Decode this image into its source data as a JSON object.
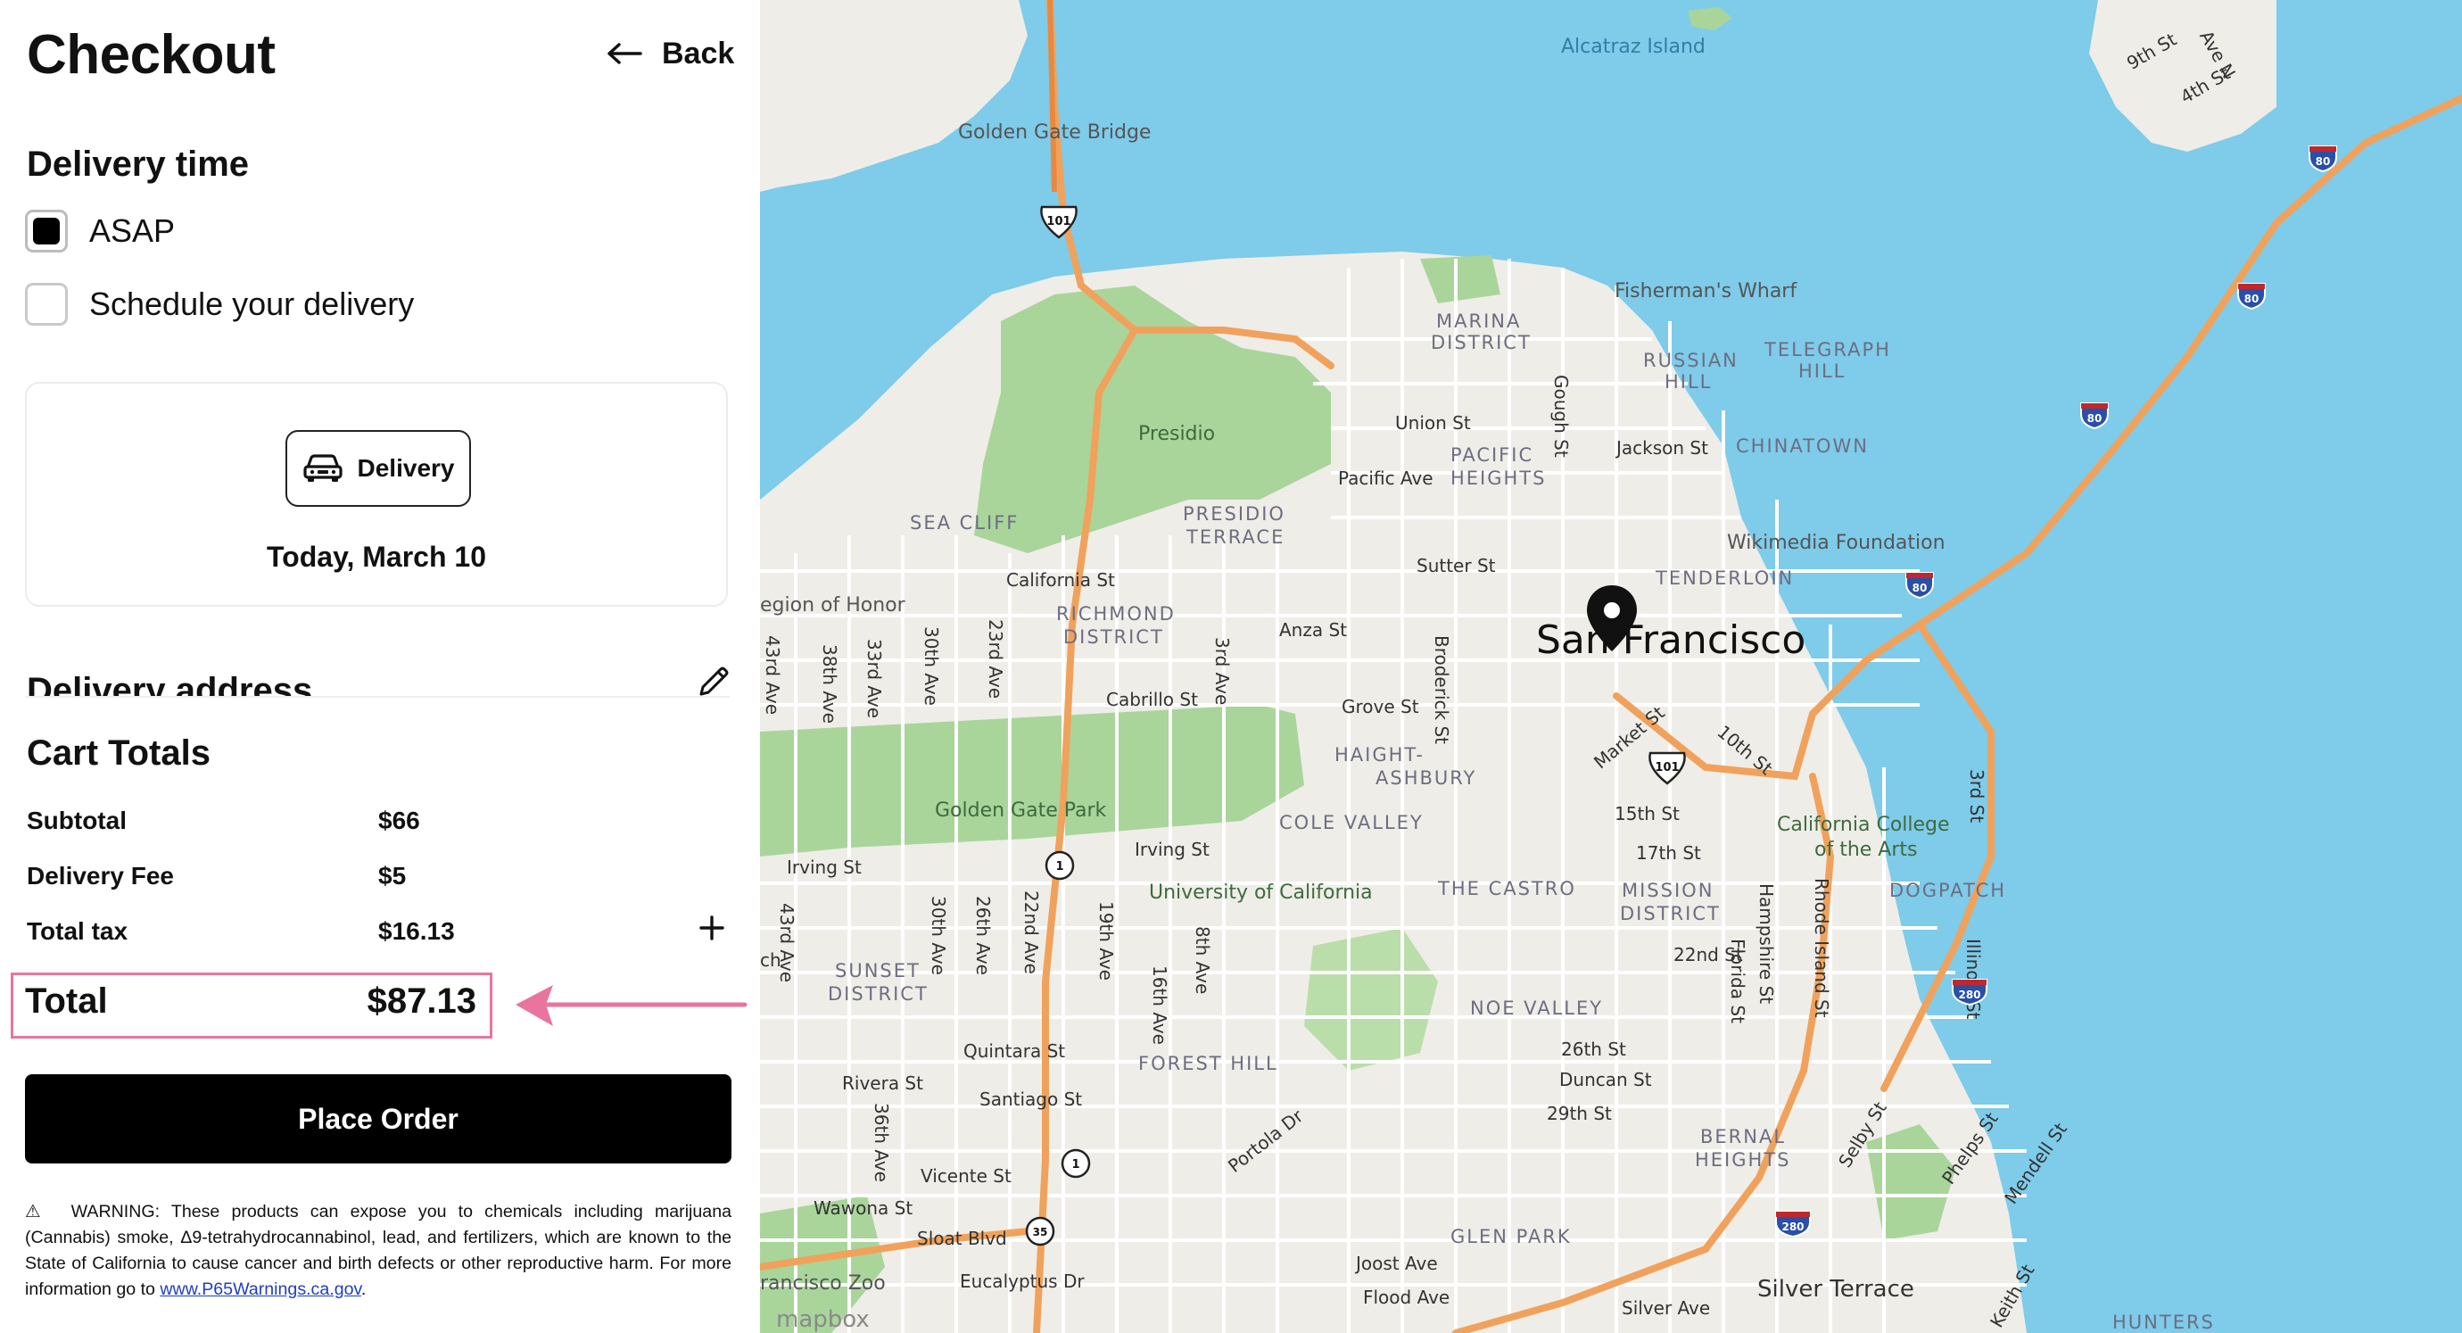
{
  "header": {
    "title": "Checkout",
    "back_label": "Back"
  },
  "delivery_time": {
    "heading": "Delivery time",
    "options": [
      {
        "label": "ASAP",
        "checked": true
      },
      {
        "label": "Schedule your delivery",
        "checked": false
      }
    ]
  },
  "fulfillment": {
    "method_label": "Delivery",
    "date": "Today, March 10"
  },
  "delivery_address": {
    "heading": "Delivery address"
  },
  "cart_totals": {
    "heading": "Cart Totals",
    "rows": [
      {
        "label": "Subtotal",
        "value": "$66"
      },
      {
        "label": "Delivery Fee",
        "value": "$5"
      },
      {
        "label": "Total tax",
        "value": "$16.13"
      }
    ],
    "total_label": "Total",
    "total_value": "$87.13",
    "highlight_color": "#e8759e"
  },
  "actions": {
    "place_order_label": "Place Order"
  },
  "warning": {
    "symbol": "⚠",
    "text": "WARNING: These products can expose you to chemicals including marijuana (Cannabis) smoke, Δ9-tetrahydrocannabinol, lead, and fertilizers, which are known to the State of California to cause cancer and birth defects or other reproductive harm. For more information go to",
    "link_text": "www.P65Warnings.ca.gov",
    "suffix": "."
  },
  "map": {
    "city": "San Francisco",
    "attribution": "mapbox",
    "colors": {
      "water": "#7ecbea",
      "land": "#efede8",
      "park": "#a9d59b",
      "highway": "#f0a25c"
    },
    "labels": {
      "alcatraz": "Alcatraz Island",
      "golden_gate_bridge": "Golden Gate Bridge",
      "fishermans_wharf": "Fisherman's Wharf",
      "marina": "MARINA",
      "district": "DISTRICT",
      "russian": "RUSSIAN",
      "hill": "HILL",
      "telegraph": "TELEGRAPH",
      "union_st": "Union St",
      "gough_st": "Gough St",
      "jackson_st": "Jackson St",
      "chinatown": "CHINATOWN",
      "presidio": "Presidio",
      "pacific": "PACIFIC",
      "heights": "HEIGHTS",
      "pacific_ave": "Pacific Ave",
      "sea_cliff": "SEA CLIFF",
      "presidio_upper": "PRESIDIO",
      "terrace": "TERRACE",
      "wikimedia": "Wikimedia Foundation",
      "sutter_st": "Sutter St",
      "california_st": "California St",
      "legion": "egion of Honor",
      "richmond": "RICHMOND",
      "tenderloin": "TENDERLOIN",
      "anza_st": "Anza St",
      "ave_43": "43rd Ave",
      "ave_38": "38th Ave",
      "ave_33": "33rd Ave",
      "ave_30": "30th Ave",
      "ave_23": "23rd Ave",
      "cabrillo_st": "Cabrillo St",
      "ave_3": "3rd Ave",
      "broderick_st": "Broderick St",
      "grove_st": "Grove St",
      "market_st": "Market St",
      "st_10": "10th St",
      "haight": "HAIGHT-",
      "ashbury": "ASHBURY",
      "golden_gate_park": "Golden Gate Park",
      "st_15": "15th St",
      "cole_valley": "COLE VALLEY",
      "ccac1": "California College",
      "ccac2": "of the Arts",
      "st_3": "3rd St",
      "irving_st": "Irving St",
      "st_17": "17th St",
      "ucsf": "University of California",
      "the_castro": "THE CASTRO",
      "mission": "MISSION",
      "dogpatch": "DOGPATCH",
      "ave_26": "26th Ave",
      "ave_22": "22nd Ave",
      "ave_19": "19th Ave",
      "hampshire_st": "Hampshire St",
      "rhode_island_st": "Rhode Island St",
      "illinois_st": "Illinois St",
      "st_22": "22nd St",
      "florida_st": "Florida St",
      "sunset": "SUNSET",
      "ave_8": "8th Ave",
      "noe_valley": "NOE VALLEY",
      "ave_16": "16th Ave",
      "quintara_st": "Quintara St",
      "forest_hill": "FOREST HILL",
      "st_26": "26th St",
      "rivera_st": "Rivera St",
      "santiago_st": "Santiago St",
      "duncan_st": "Duncan St",
      "ave_36": "36th Ave",
      "st_29": "29th St",
      "portola_dr": "Portola Dr",
      "selby_st": "Selby St",
      "bernal": "BERNAL",
      "vicente_st": "Vicente St",
      "phelps_st": "Phelps St",
      "mendell_st": "Mendell St",
      "wawona_st": "Wawona St",
      "glen_park": "GLEN PARK",
      "sloat_blvd": "Sloat Blvd",
      "joost_ave": "Joost Ave",
      "sf_zoo": "rancisco Zoo",
      "eucalyptus_dr": "Eucalyptus Dr",
      "flood_ave": "Flood Ave",
      "silver_terrace": "Silver Terrace",
      "silver_ave": "Silver Ave",
      "st_9": "9th St",
      "st_4": "4th St",
      "ave_n": "Ave N",
      "keith_st": "Keith St",
      "hunters": "HUNTERS",
      "ch": "ch"
    },
    "shields": {
      "us101": "101",
      "i80": "80",
      "i280": "280",
      "sr1": "1",
      "sr35": "35"
    }
  }
}
